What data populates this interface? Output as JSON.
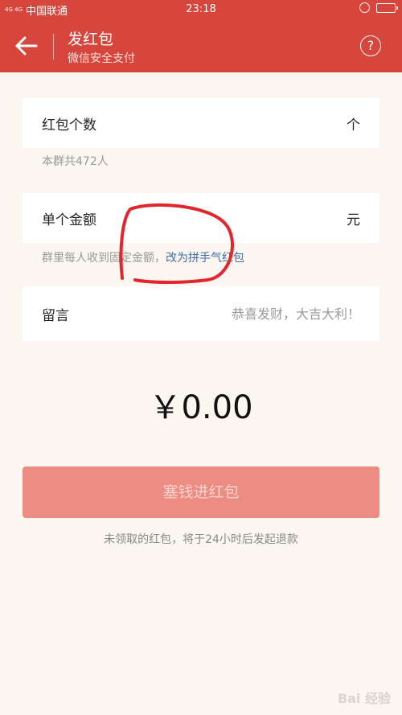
{
  "status_bar": {
    "network": "4G 4G",
    "carrier": "中国联通",
    "time": "23:18"
  },
  "header": {
    "title": "发红包",
    "subtitle": "微信安全支付",
    "help_label": "?"
  },
  "count_card": {
    "label": "红包个数",
    "value": "",
    "unit": "个"
  },
  "group_hint": "本群共472人",
  "amount_card": {
    "label": "单个金额",
    "value": "",
    "unit": "元"
  },
  "amount_hint": {
    "text": "群里每人收到固定金额，",
    "link": "改为拼手气红包"
  },
  "message_card": {
    "label": "留言",
    "placeholder": "恭喜发财，大吉大利！"
  },
  "total_amount": "￥0.00",
  "submit_button": "塞钱进红包",
  "refund_notice": "未领取的红包，将于24小时后发起退款",
  "watermark": "Bai 经验",
  "colors": {
    "header_red": "#d6463c",
    "button_pink": "#ec8c83",
    "link_blue": "#3d6fa8",
    "page_bg": "#fbf6ef",
    "annotation_red": "#e3252d"
  }
}
